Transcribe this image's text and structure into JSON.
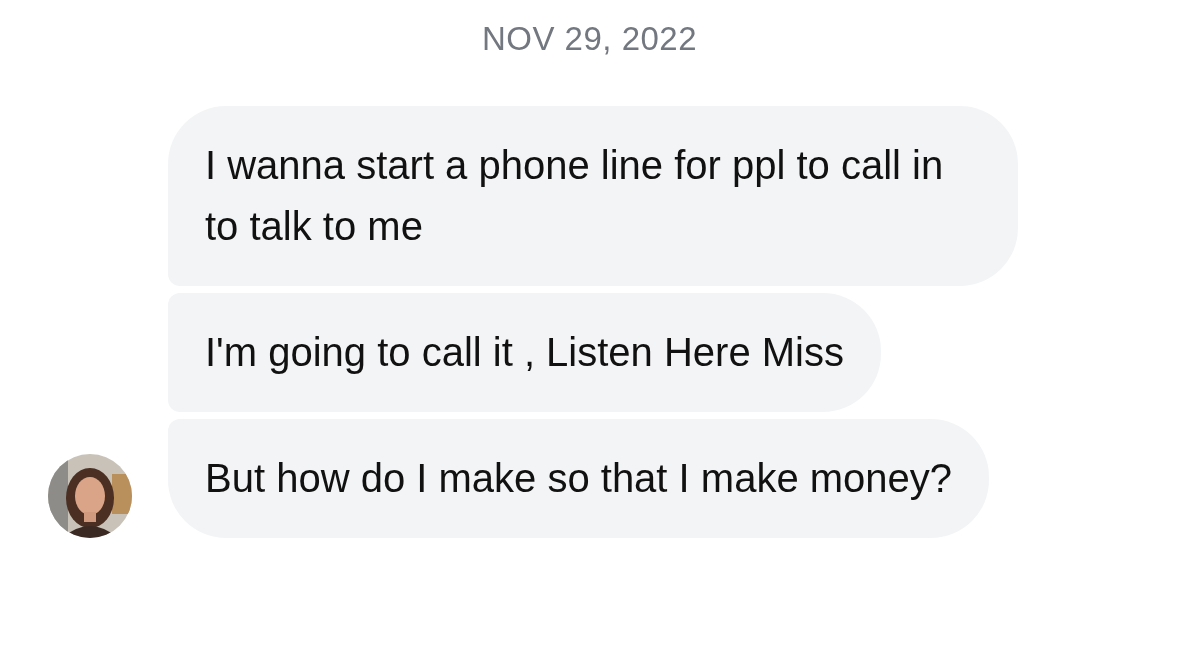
{
  "date_header": "NOV 29, 2022",
  "messages": [
    {
      "text": "I wanna start a phone line for ppl to call in to talk to me"
    },
    {
      "text": "I'm going to call it , Listen Here Miss"
    },
    {
      "text": "But how do I make so that I make money?"
    }
  ]
}
